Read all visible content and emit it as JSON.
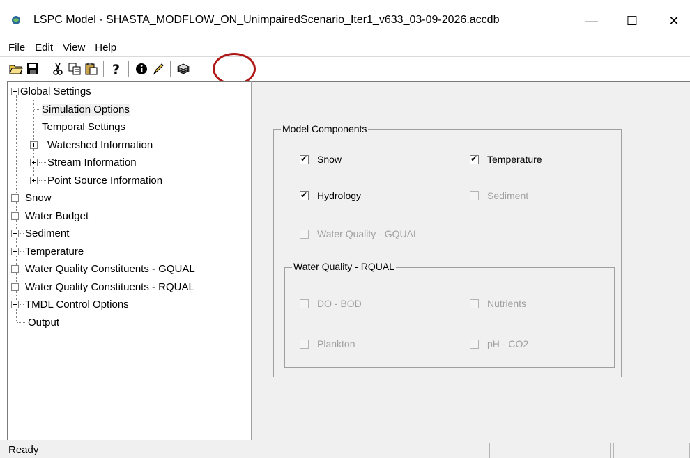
{
  "window": {
    "title": "LSPC Model - SHASTA_MODFLOW_ON_UnimpairedScenario_Iter1_v633_03-09-2026.accdb",
    "minimize": "—",
    "maximize": "☐",
    "close": "✕"
  },
  "menu": [
    "File",
    "Edit",
    "View",
    "Help"
  ],
  "toolbar": {
    "icons": [
      "open-folder-icon",
      "save-icon",
      "cut-icon",
      "copy-icon",
      "paste-icon",
      "help-icon",
      "info-icon",
      "edit-pencil-icon",
      "run-layers-icon"
    ]
  },
  "tree": {
    "global_settings": "Global Settings",
    "simulation_options": "Simulation Options",
    "temporal_settings": "Temporal Settings",
    "watershed_information": "Watershed Information",
    "stream_information": "Stream Information",
    "point_source_information": "Point Source Information",
    "snow": "Snow",
    "water_budget": "Water Budget",
    "sediment": "Sediment",
    "temperature": "Temperature",
    "wq_gqual": "Water Quality Constituents - GQUAL",
    "wq_rqual": "Water Quality Constituents - RQUAL",
    "tmdl": "TMDL Control Options",
    "output": "Output"
  },
  "model_components": {
    "title": "Model Components",
    "snow": {
      "label": "Snow",
      "checked": true,
      "enabled": true
    },
    "temperature": {
      "label": "Temperature",
      "checked": true,
      "enabled": true
    },
    "hydrology": {
      "label": "Hydrology",
      "checked": true,
      "enabled": true
    },
    "sediment": {
      "label": "Sediment",
      "checked": false,
      "enabled": false
    },
    "wq_gqual": {
      "label": "Water Quality - GQUAL",
      "checked": false,
      "enabled": false
    }
  },
  "rqual": {
    "title": "Water Quality - RQUAL",
    "do_bod": {
      "label": "DO - BOD",
      "checked": false,
      "enabled": false
    },
    "nutrients": {
      "label": "Nutrients",
      "checked": false,
      "enabled": false
    },
    "plankton": {
      "label": "Plankton",
      "checked": false,
      "enabled": false
    },
    "ph_co2": {
      "label": "pH - CO2",
      "checked": false,
      "enabled": false
    }
  },
  "status": {
    "text": "Ready"
  },
  "colors": {
    "highlight": "#b01818",
    "panel_bg": "#f0f0f0"
  }
}
